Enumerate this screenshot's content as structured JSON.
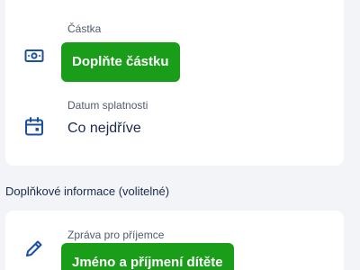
{
  "amount": {
    "icon": "banknote-icon",
    "label": "Částka",
    "button_label": "Doplňte částku"
  },
  "due_date": {
    "icon": "calendar-icon",
    "label": "Datum splatnosti",
    "value": "Co nejdříve"
  },
  "additional": {
    "section_title": "Doplňkové informace (volitelné)",
    "message": {
      "icon": "pencil-icon",
      "label": "Zpráva pro příjemce",
      "button_label": "Jméno a příjmení dítěte"
    }
  },
  "colors": {
    "accent_green": "#1a9e1a",
    "icon_blue": "#1b4fa0",
    "text_dark": "#1b2a4a",
    "background": "#f2f4f8"
  }
}
